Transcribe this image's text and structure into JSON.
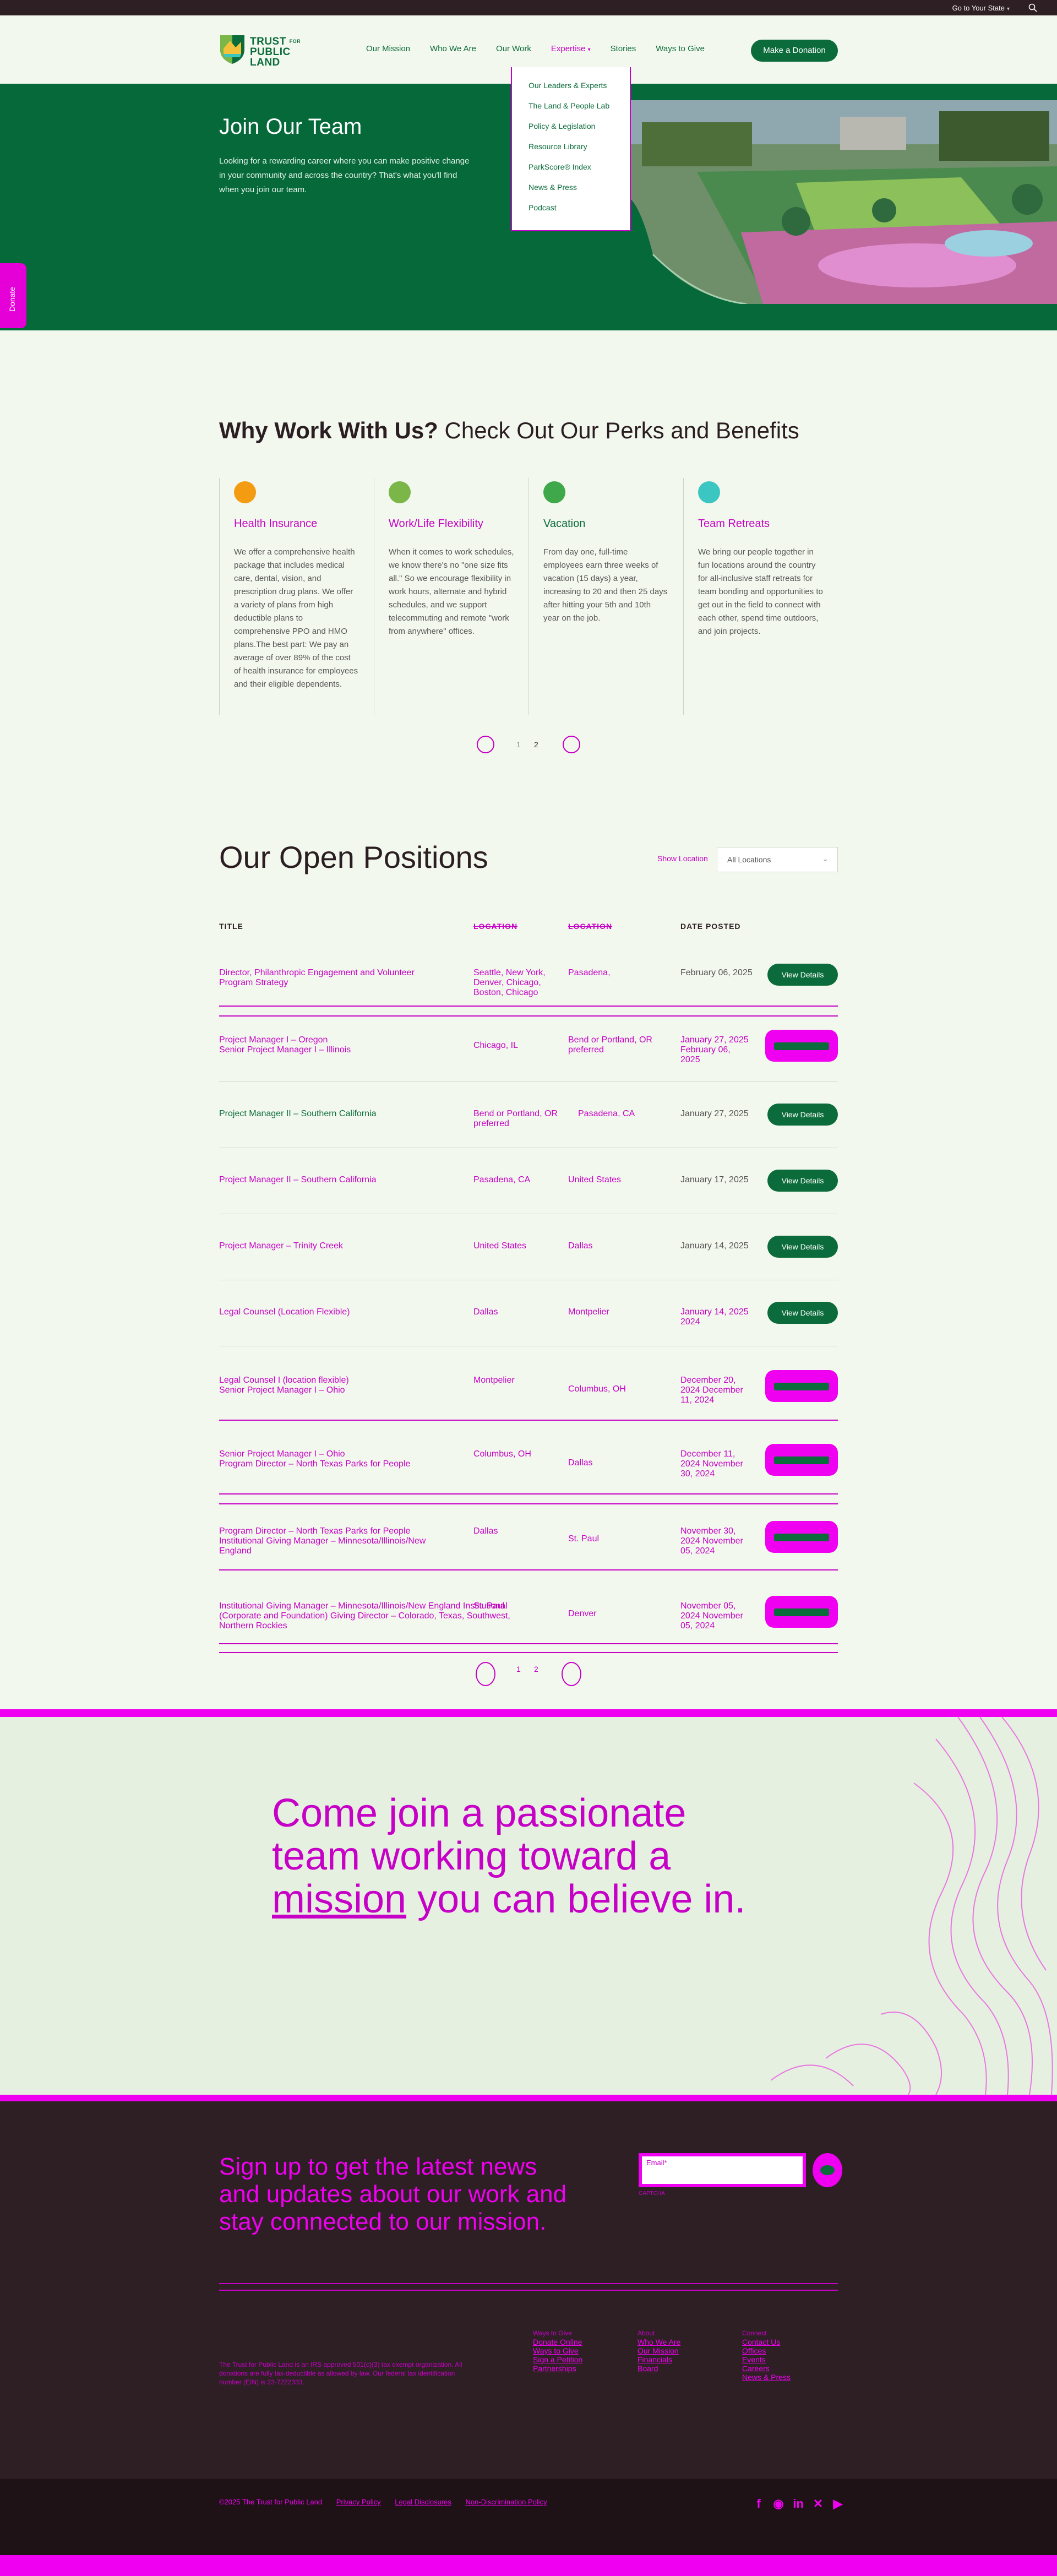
{
  "utility": {
    "state_label": "Go to Your State"
  },
  "header": {
    "logo": {
      "line1": "TRUST",
      "line1_small": "FOR",
      "line2": "PUBLIC",
      "line3": "LAND"
    },
    "nav": [
      "Our Mission",
      "Who We Are",
      "Our Work",
      "Expertise",
      "Stories",
      "Ways to Give"
    ],
    "donate_label": "Make a Donation"
  },
  "dropdown": [
    "Our Leaders & Experts",
    "The Land & People Lab",
    "Policy & Legislation",
    "Resource Library",
    "ParkScore® Index",
    "News & Press",
    "Podcast"
  ],
  "hero": {
    "title": "Join Our Team",
    "body": "Looking for a rewarding career where you can make positive change in your community and across the country? That's what you'll find when you join our team."
  },
  "side_donate": "Donate",
  "perks": {
    "title_bold": "Why Work With Us?",
    "title_rest": " Check Out Our Perks and Benefits",
    "cards": [
      {
        "title": "Health Insurance",
        "icon": "health-icon",
        "color": "#f39c12",
        "body": "We offer a comprehensive health package that includes medical care, dental, vision, and prescription drug plans. We offer a variety of plans from high deductible plans to comprehensive PPO and HMO plans.The best part: We pay an average of over 89% of the cost of health insurance for employees and their eligible dependents."
      },
      {
        "title": "Work/Life Flexibility",
        "icon": "flexibility-icon",
        "color": "#7ab648",
        "body": "When it comes to work schedules, we know there's no \"one size fits all.\" So we encourage flexibility in work hours, alternate and hybrid schedules, and we support telecommuting and remote \"work from anywhere\" offices."
      },
      {
        "title": "Vacation",
        "icon": "vacation-icon",
        "color": "#3ea84a",
        "body": "From day one, full-time employees earn three weeks of vacation (15 days) a year, increasing to 20 and then 25 days after hitting your 5th and 10th year on the job."
      },
      {
        "title": "Team Retreats",
        "icon": "retreat-icon",
        "color": "#3cc6c2",
        "body": "We bring our people together in fun locations around the country for all-inclusive staff retreats for team bonding and opportunities to get out in the field to connect with each other, spend time outdoors, and join projects."
      }
    ],
    "pages": [
      "1",
      "2"
    ]
  },
  "positions": {
    "title": "Our Open Positions",
    "filter_label": "Show Location",
    "filter_value": "All Locations",
    "headers": [
      "TITLE",
      "LOCATION",
      "LOCATION",
      "DATE POSTED"
    ],
    "rows": [
      {
        "title": "Director, Philanthropic Engagement and Volunteer Program Strategy",
        "title2": "Senior Project Manager I – Illinois",
        "loc1": "Seattle, New York, Denver, Chicago, Boston, Chicago",
        "loc2": "Pasadena,",
        "date": "February 06, 2025",
        "date2": "",
        "button": "View Details",
        "style": "green"
      },
      {
        "title": "Project Manager I – Oregon",
        "title2": "Senior Project Manager I – Illinois",
        "loc1": "Chicago, IL",
        "loc2": "Bend or Portland, OR preferred",
        "date": "January 27, 2025",
        "date2": "February 06, 2025",
        "button": "View Details",
        "style": "magenta"
      },
      {
        "title": "Project Manager II – Southern California",
        "title2": "",
        "loc1": "Bend or Portland, OR preferred",
        "loc2": "Pasadena, CA",
        "date": "January 27, 2025",
        "date2": "",
        "button": "View Details",
        "style": "green"
      },
      {
        "title": "Project Manager II – Southern California",
        "title2": "",
        "loc1": "Pasadena, CA",
        "loc2": "United States",
        "date": "January 17, 2025",
        "date2": "",
        "button": "View Details",
        "style": "green"
      },
      {
        "title": "Project Manager – Trinity Creek",
        "title2": "",
        "loc1": "United States",
        "loc2": "Dallas",
        "date": "January 14, 2025",
        "date2": "",
        "button": "View Details",
        "style": "green"
      },
      {
        "title": "Legal Counsel (Location Flexible)",
        "title2": "",
        "loc1": "Dallas",
        "loc2": "Montpelier",
        "date": "January 14, 2025",
        "date2": "2024",
        "button": "View Details",
        "style": "green"
      },
      {
        "title": "Legal Counsel I (location flexible)",
        "title2": "Senior Project Manager I – Ohio",
        "loc1": "Montpelier",
        "loc2": "Columbus, OH",
        "date": "December 20, 2024",
        "date2": "December 11, 2024",
        "button": "View Details",
        "style": "magenta"
      },
      {
        "title": "Senior Project Manager I – Ohio",
        "title2": "Program Director – North Texas Parks for People",
        "loc1": "Columbus, OH",
        "loc2": "Dallas",
        "date": "December 11, 2024",
        "date2": "November 30, 2024",
        "button": "View Details",
        "style": "magenta"
      },
      {
        "title": "Program Director – North Texas Parks for People",
        "title2": "Institutional Giving Manager – Minnesota/Illinois/New England",
        "loc1": "Dallas",
        "loc2": "St. Paul",
        "date": "November 30, 2024",
        "date2": "November 05, 2024",
        "button": "View Details",
        "style": "magenta"
      },
      {
        "title": "Institutional Giving Manager – Minnesota/Illinois/New England",
        "title2": "Institutional (Corporate and Foundation) Giving Director – Colorado, Texas, Southwest, Northern Rockies",
        "loc1": "St. Paul",
        "loc2": "Denver",
        "date": "November 05, 2024",
        "date2": "November 05, 2024",
        "button": "View Details",
        "style": "magenta"
      }
    ],
    "pages": [
      "1",
      "2"
    ]
  },
  "join": {
    "line1": "Come join a passionate",
    "line2": "team working toward a",
    "line3a": "mission",
    "line3b": " you can believe in."
  },
  "footer": {
    "signup": "Sign up to get the latest news and updates about our work and stay connected to our mission.",
    "email_placeholder": "Email*",
    "captcha": "CAPTCHA",
    "about": "The Trust for Public Land is an IRS approved 501(c)(3) tax exempt organization. All donations are fully tax-deductible as allowed by law. Our federal tax identification number (EIN) is 23-7222333.",
    "col1_head": "Ways to Give",
    "col1": [
      "Donate Online",
      "Ways to Give",
      "Sign a Petition",
      "Partnerships"
    ],
    "col2_head": "About",
    "col2": [
      "Who We Are",
      "Our Mission",
      "Financials",
      "Board"
    ],
    "col3_head": "Connect",
    "col3": [
      "Contact Us",
      "Offices",
      "Events",
      "Careers",
      "News & Press"
    ]
  },
  "bottom": {
    "copyright": "©2025 The Trust for Public Land",
    "links": [
      "Privacy Policy",
      "Legal Disclosures",
      "Non-Discrimination Policy"
    ]
  }
}
